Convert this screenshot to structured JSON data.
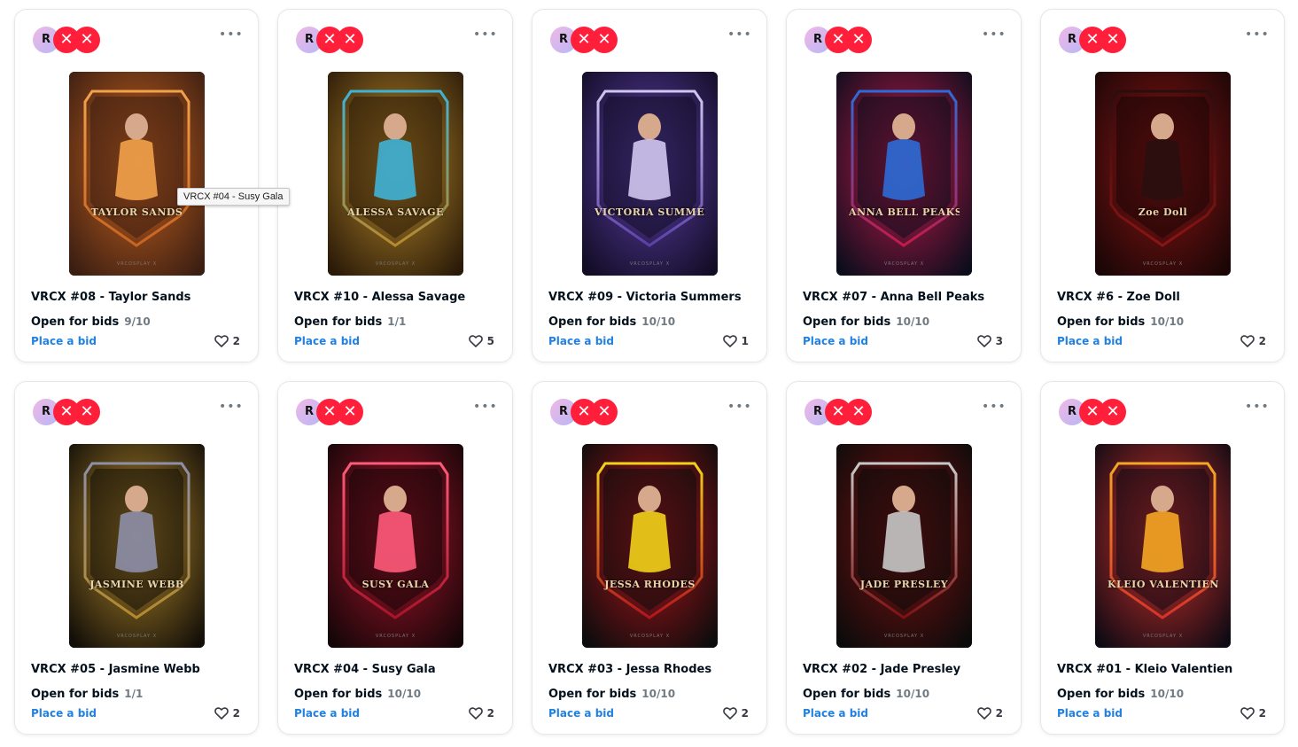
{
  "cards": [
    {
      "title": "VRCX #08 - Taylor Sands",
      "status": "Open for bids",
      "editions": "9/10",
      "bid_label": "Place a bid",
      "likes": "2",
      "art_name": "TAYLOR SANDS",
      "palette": [
        "#3a1e12",
        "#c9631f",
        "#f2a24a"
      ]
    },
    {
      "title": "VRCX #10 - Alessa Savage",
      "status": "Open for bids",
      "editions": "1/1",
      "bid_label": "Place a bid",
      "likes": "5",
      "art_name": "ALESSA SAVAGE",
      "palette": [
        "#2a1a08",
        "#b8892b",
        "#3fb3d6"
      ]
    },
    {
      "title": "VRCX #09 - Victoria Summers",
      "status": "Open for bids",
      "editions": "10/10",
      "bid_label": "Place a bid",
      "likes": "1",
      "art_name": "VICTORIA SUMMERS",
      "palette": [
        "#120c24",
        "#5b3fa8",
        "#d2c7ef"
      ]
    },
    {
      "title": "VRCX #07 - Anna Bell Peaks",
      "status": "Open for bids",
      "editions": "10/10",
      "bid_label": "Place a bid",
      "likes": "3",
      "art_name": "ANNA BELL PEAKS",
      "palette": [
        "#0b0d1c",
        "#c21a4a",
        "#2e6bd6"
      ]
    },
    {
      "title": "VRCX #6 - Zoe Doll",
      "status": "Open for bids",
      "editions": "10/10",
      "bid_label": "Place a bid",
      "likes": "2",
      "art_name": "Zoe Doll",
      "palette": [
        "#1a0606",
        "#8c1414",
        "#2a0e0e"
      ]
    },
    {
      "title": "VRCX #05 - Jasmine Webb",
      "status": "Open for bids",
      "editions": "1/1",
      "bid_label": "Place a bid",
      "likes": "2",
      "art_name": "JASMINE WEBB",
      "palette": [
        "#120e08",
        "#b58a2c",
        "#8e8fa8"
      ]
    },
    {
      "title": "VRCX #04 - Susy Gala",
      "status": "Open for bids",
      "editions": "10/10",
      "bid_label": "Place a bid",
      "likes": "2",
      "art_name": "SUSY GALA",
      "palette": [
        "#140608",
        "#a8142a",
        "#ff5a7a"
      ]
    },
    {
      "title": "VRCX #03 - Jessa Rhodes",
      "status": "Open for bids",
      "editions": "10/10",
      "bid_label": "Place a bid",
      "likes": "2",
      "art_name": "JESSA RHODES",
      "palette": [
        "#0c0c0c",
        "#b3141c",
        "#f2d21a"
      ]
    },
    {
      "title": "VRCX #02 - Jade Presley",
      "status": "Open for bids",
      "editions": "10/10",
      "bid_label": "Place a bid",
      "likes": "2",
      "art_name": "JADE PRESLEY",
      "palette": [
        "#0b0b0b",
        "#7d1010",
        "#c8c8c8"
      ]
    },
    {
      "title": "VRCX #01 - Kleio Valentien",
      "status": "Open for bids",
      "editions": "10/10",
      "bid_label": "Place a bid",
      "likes": "2",
      "art_name": "KLEIO VALENTIEN",
      "palette": [
        "#0e0a14",
        "#d6322a",
        "#f5a623"
      ]
    }
  ],
  "collection_avatar": {
    "letter": "R",
    "badge_glyph": "✕"
  },
  "more_glyph": "•••",
  "brand_mark": "VRCOSPLAY X",
  "tooltip": "VRCX #04 - Susy Gala",
  "colors": {
    "link": "#2081e2",
    "muted": "#707a83",
    "badge_red": "#ff1f3a",
    "border": "#e5e8eb"
  }
}
